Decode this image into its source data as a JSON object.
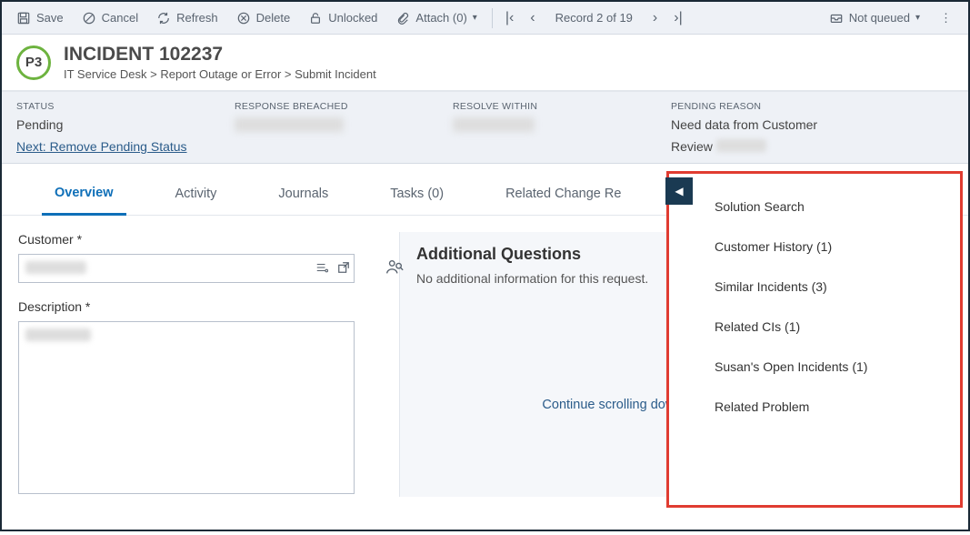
{
  "toolbar": {
    "save": "Save",
    "cancel": "Cancel",
    "refresh": "Refresh",
    "delete": "Delete",
    "unlocked": "Unlocked",
    "attach": "Attach (0)",
    "record_text": "Record 2 of 19",
    "not_queued": "Not queued"
  },
  "header": {
    "priority": "P3",
    "title": "INCIDENT 102237",
    "breadcrumb": "IT Service Desk > Report Outage or Error > Submit Incident"
  },
  "status": {
    "status_label": "STATUS",
    "status_value": "Pending",
    "next_link": "Next: Remove Pending Status",
    "response_label": "RESPONSE BREACHED",
    "resolve_label": "RESOLVE WITHIN",
    "pending_label": "PENDING REASON",
    "pending_value": "Need data from Customer",
    "review_prefix": "Review"
  },
  "tabs": {
    "overview": "Overview",
    "activity": "Activity",
    "journals": "Journals",
    "tasks": "Tasks (0)",
    "related": "Related Change Re"
  },
  "form": {
    "customer_label": "Customer *",
    "description_label": "Description *",
    "additional_title": "Additional Questions",
    "additional_text": "No additional information for this request.",
    "scroll_hint": "Continue scrolling down to complete the form."
  },
  "side": {
    "items": [
      "Solution Search",
      "Customer History (1)",
      "Similar Incidents (3)",
      "Related CIs (1)",
      "Susan's Open Incidents (1)",
      "Related Problem"
    ]
  }
}
